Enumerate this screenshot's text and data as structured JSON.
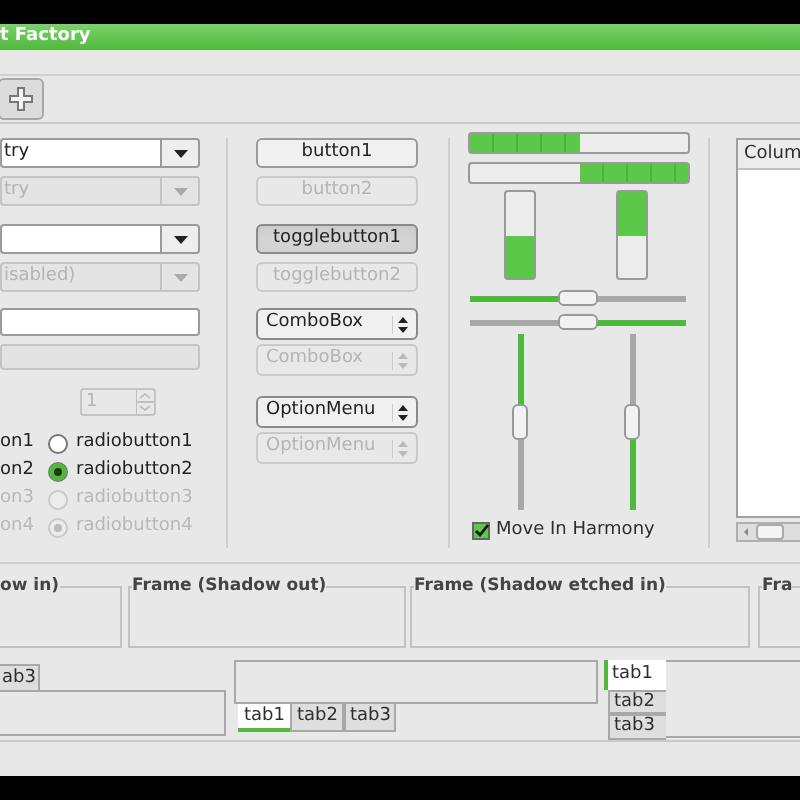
{
  "window": {
    "title": "t Factory"
  },
  "combo_entries": [
    {
      "value": "try",
      "disabled": false
    },
    {
      "value": "try",
      "disabled": true
    },
    {
      "disabled": false
    },
    {
      "value": "isabled)",
      "disabled": true
    }
  ],
  "entries": [
    {
      "disabled": false
    },
    {
      "disabled": true
    }
  ],
  "spin": {
    "value": "1",
    "disabled": true
  },
  "radio_labels": [
    {
      "label": "on1",
      "disabled": false
    },
    {
      "label": "on2",
      "disabled": false
    },
    {
      "label": "on3",
      "disabled": true
    },
    {
      "label": "on4",
      "disabled": true
    }
  ],
  "radios": [
    {
      "label": "radiobutton1",
      "selected": false,
      "disabled": false
    },
    {
      "label": "radiobutton2",
      "selected": true,
      "disabled": false
    },
    {
      "label": "radiobutton3",
      "selected": false,
      "disabled": true
    },
    {
      "label": "radiobutton4",
      "selected": true,
      "disabled": true
    }
  ],
  "buttons": [
    {
      "label": "button1",
      "disabled": false
    },
    {
      "label": "button2",
      "disabled": true
    }
  ],
  "toggle_buttons": [
    {
      "label": "togglebutton1",
      "on": true,
      "disabled": false
    },
    {
      "label": "togglebutton2",
      "on": false,
      "disabled": true
    }
  ],
  "combo_boxes": [
    {
      "label": "ComboBox",
      "disabled": false
    },
    {
      "label": "ComboBox",
      "disabled": true
    }
  ],
  "option_menus": [
    {
      "label": "OptionMenu",
      "disabled": false
    },
    {
      "label": "OptionMenu",
      "disabled": true
    }
  ],
  "progress_bars": [
    {
      "level": 0.5,
      "inverted": false
    },
    {
      "level": 0.5,
      "inverted": true
    },
    {
      "level": 0.5,
      "inverted": false
    },
    {
      "level": 0.5,
      "inverted": true
    }
  ],
  "scales": [
    {
      "level": 0.5,
      "inverted": false
    },
    {
      "level": 0.5,
      "inverted": true
    },
    {
      "level": 0.5,
      "inverted": false
    },
    {
      "level": 0.5,
      "inverted": true
    }
  ],
  "harmony": {
    "label": "Move In Harmony",
    "checked": true
  },
  "tree": {
    "columns": [
      "Colum"
    ]
  },
  "frames": [
    {
      "label": "ow in)"
    },
    {
      "label": "Frame (Shadow out)"
    },
    {
      "label": "Frame (Shadow etched in)"
    },
    {
      "label": "Fra"
    }
  ],
  "notebooks": [
    {
      "tabs": [
        {
          "label": "ab3",
          "selected": false
        }
      ]
    },
    {
      "tabs": [
        {
          "label": "tab1",
          "selected": true
        },
        {
          "label": "tab2",
          "selected": false
        },
        {
          "label": "tab3",
          "selected": false
        }
      ]
    },
    {
      "tabs": [
        {
          "label": "tab1",
          "selected": true
        },
        {
          "label": "tab2",
          "selected": false
        },
        {
          "label": "tab3",
          "selected": false
        }
      ]
    }
  ]
}
